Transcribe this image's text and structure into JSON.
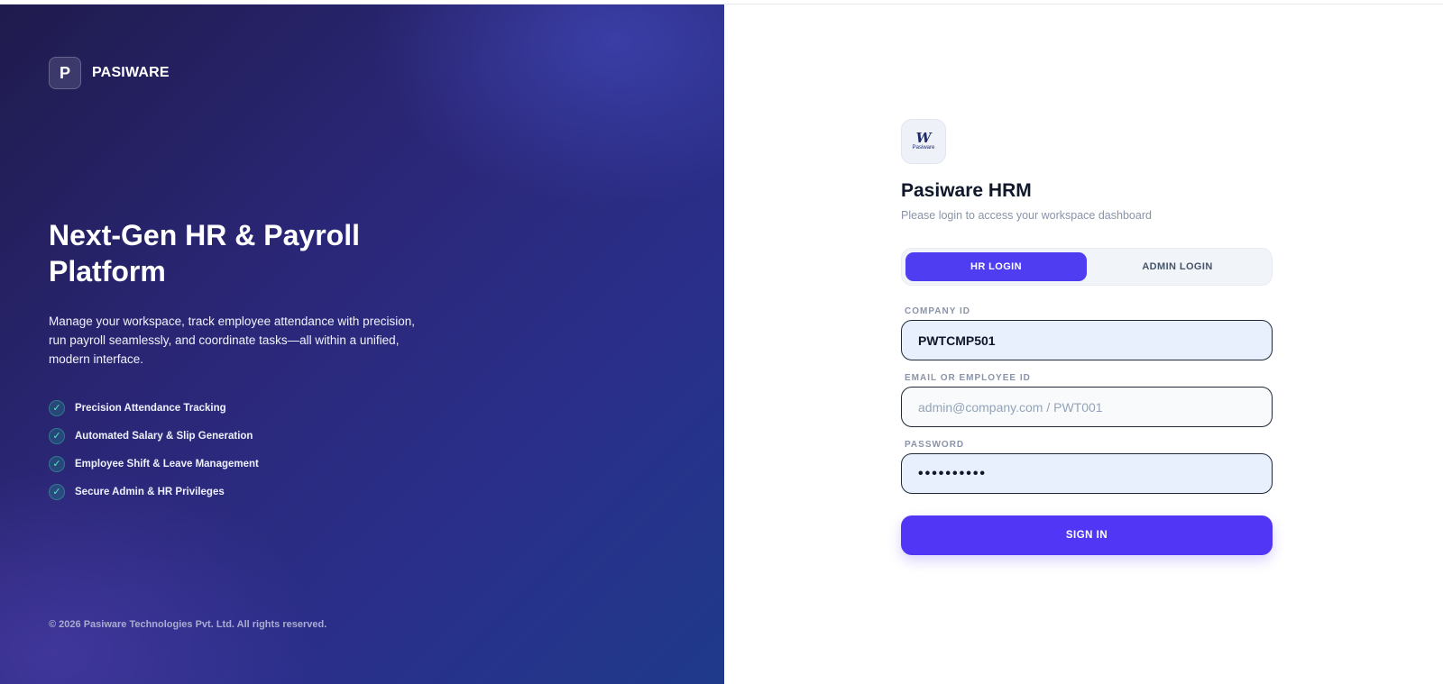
{
  "left": {
    "brand": {
      "mark": "P",
      "name": "PASIWARE",
      "icon": "brand-letter-icon"
    },
    "hero_title": "Next-Gen HR & Payroll Platform",
    "hero_description": "Manage your workspace, track employee attendance with precision, run payroll seamlessly, and coordinate tasks—all within a unified, modern interface.",
    "features": [
      {
        "label": "Precision Attendance Tracking",
        "icon": "check-icon"
      },
      {
        "label": "Automated Salary & Slip Generation",
        "icon": "check-icon"
      },
      {
        "label": "Employee Shift & Leave Management",
        "icon": "check-icon"
      },
      {
        "label": "Secure Admin & HR Privileges",
        "icon": "check-icon"
      }
    ],
    "copyright": "© 2026 Pasiware Technologies Pvt. Ltd. All rights reserved."
  },
  "login": {
    "logo": {
      "glyph": "W",
      "text": "Pasiware"
    },
    "title": "Pasiware HRM",
    "subtitle": "Please login to access your workspace dashboard",
    "tabs": [
      {
        "label": "HR LOGIN",
        "active": true
      },
      {
        "label": "ADMIN LOGIN",
        "active": false
      }
    ],
    "company_id": {
      "label": "COMPANY ID",
      "value": "PWTCMP501"
    },
    "email": {
      "label": "EMAIL OR EMPLOYEE ID",
      "value": "",
      "placeholder": "admin@company.com / PWT001"
    },
    "password": {
      "label": "PASSWORD",
      "value": "••••••••••"
    },
    "sign_in_label": "SIGN IN"
  },
  "colors": {
    "accent": "#4f3df2",
    "panel_dark": "#2b2778",
    "title_text": "#0f172a",
    "muted_text": "#8a94a8",
    "check": "#5fe3c4"
  }
}
